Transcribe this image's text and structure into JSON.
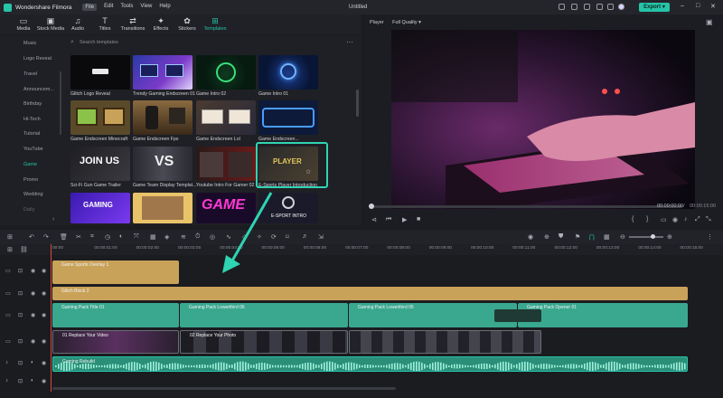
{
  "app": {
    "name": "Wondershare Filmora",
    "doc_title": "Untitled",
    "export_label": "Export",
    "menu": [
      "File",
      "Edit",
      "Tools",
      "View",
      "Help"
    ]
  },
  "media_tabs": [
    {
      "label": "Media",
      "icon": "media-icon"
    },
    {
      "label": "Stock Media",
      "icon": "stock-media-icon"
    },
    {
      "label": "Audio",
      "icon": "audio-icon"
    },
    {
      "label": "Titles",
      "icon": "titles-icon"
    },
    {
      "label": "Transitions",
      "icon": "transitions-icon"
    },
    {
      "label": "Effects",
      "icon": "effects-icon"
    },
    {
      "label": "Stickers",
      "icon": "stickers-icon"
    },
    {
      "label": "Templates",
      "icon": "templates-icon",
      "active": true
    }
  ],
  "sidebar": [
    "Music",
    "Logo Reveal",
    "Travel",
    "Announcem...",
    "Birthday",
    "Hi-Tech",
    "Tutorial",
    "YouTube",
    "Game",
    "Promo",
    "Wedding",
    "Daily"
  ],
  "search_placeholder": "Search templates",
  "templates": [
    "Glitch Logo Reveal",
    "Trendy Gaming Endscreen 01",
    "Game Intro 02",
    "Game Intro 01",
    "Game Endscreen Minecraft",
    "Game Endscreen Fps",
    "Game Endscreen Lol",
    "Game Endscreen...",
    "Sci-Fi Gun Game Trailer",
    "Game Team Display Templat...",
    "Youtube Intro For Gamer 02",
    "E-Sports Player Introduction",
    "",
    "",
    "",
    ""
  ],
  "thumb_texts": {
    "join_us": "JOIN US",
    "gaming": "GAMING",
    "game": "GAME",
    "player": "PLAYER",
    "esport": "E-SPORT INTRO",
    "vs": "VS"
  },
  "player": {
    "tab": "Player",
    "quality": "Full Quality",
    "current_time": "00:00:00:00",
    "total_time": "00:00:15:00"
  },
  "ruler_ticks": [
    "00:00",
    "00:00:01:00",
    "00:00:02:00",
    "00:00:03:00",
    "00:00:04:00",
    "00:00:05:00",
    "00:00:06:00",
    "00:00:07:00",
    "00:00:08:00",
    "00:00:09:00",
    "00:00:10:00",
    "00:00:11:00",
    "00:00:12:00",
    "00:00:13:00",
    "00:00:14:00",
    "00:00:15:00"
  ],
  "clips": {
    "overlay": "Game Sports Overlay 1",
    "glitch": "Glitch Block 2",
    "t1": "Gaming Pack Title 01",
    "lt06": "Gaming Pack Lowerthird 06",
    "lt05": "Gaming Pack Lowerthird 05",
    "opener": "Gaming Pack Opener 01",
    "replace1": "01 Replace Your Video",
    "replace2": "02 Replace Your Photo",
    "audio": "Gaming Rebuild"
  },
  "colors": {
    "accent": "#26c4a8",
    "gold": "#c9a259",
    "teal": "#3aa88f",
    "playhead": "#e0463c"
  }
}
